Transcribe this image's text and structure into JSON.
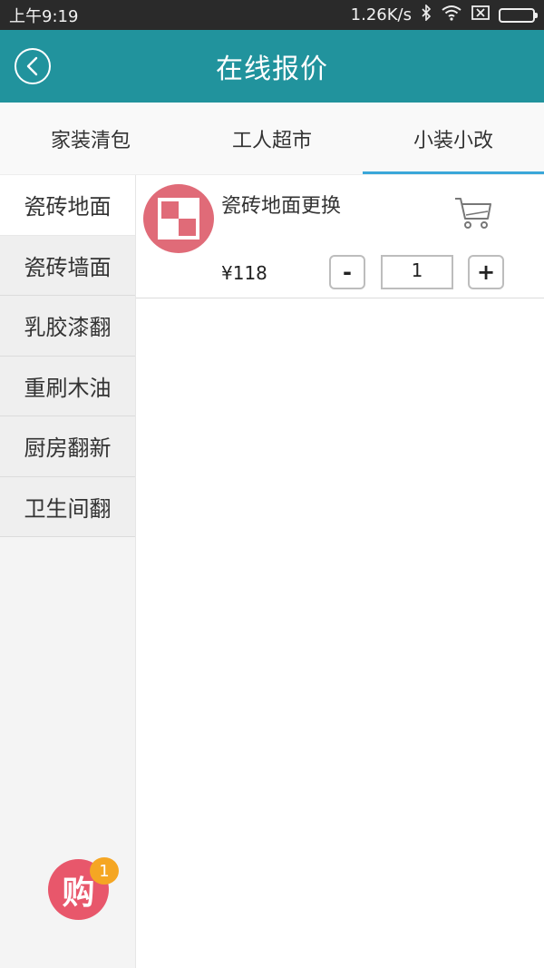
{
  "status_bar": {
    "time": "上午9:19",
    "speed": "1.26K/s",
    "bluetooth_icon": "bluetooth-icon",
    "wifi_icon": "wifi-icon",
    "sim_icon": "no-sim-icon",
    "battery_icon": "battery-icon"
  },
  "header": {
    "title": "在线报价",
    "back_icon": "back-chevron-icon",
    "bg_color": "#21939d"
  },
  "tabs": [
    {
      "label": "家装清包",
      "active": false
    },
    {
      "label": "工人超市",
      "active": false
    },
    {
      "label": "小装小改",
      "active": true
    }
  ],
  "sidebar": {
    "items": [
      {
        "label": "瓷砖地面",
        "active": true
      },
      {
        "label": "瓷砖墙面",
        "active": false
      },
      {
        "label": "乳胶漆翻",
        "active": false
      },
      {
        "label": "重刷木油",
        "active": false
      },
      {
        "label": "厨房翻新",
        "active": false
      },
      {
        "label": "卫生间翻",
        "active": false
      }
    ]
  },
  "products": [
    {
      "name": "瓷砖地面更换",
      "price": "¥118",
      "quantity": "1",
      "minus_label": "-",
      "plus_label": "+",
      "cart_icon": "cart-icon",
      "image_icon": "tile-icon"
    }
  ],
  "cart_badge": {
    "label": "购",
    "count": "1",
    "color": "#e8576b",
    "badge_color": "#f5a623"
  }
}
